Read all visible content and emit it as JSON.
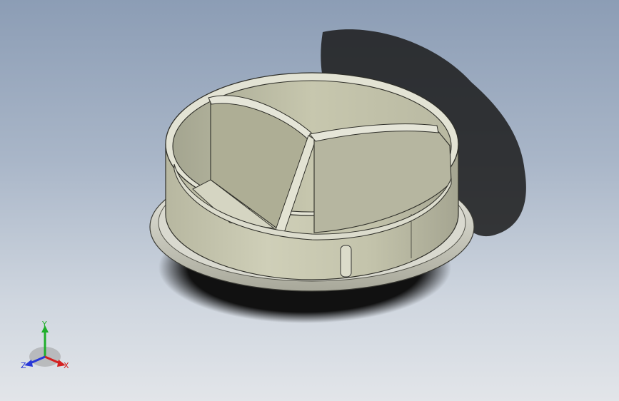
{
  "triad": {
    "x_label": "X",
    "y_label": "Y",
    "z_label": "Z",
    "x_color": "#d42020",
    "y_color": "#1fae2a",
    "z_color": "#2838d8"
  },
  "model": {
    "shell_color": "#c9c9b0",
    "shadow_color": "#161616"
  }
}
